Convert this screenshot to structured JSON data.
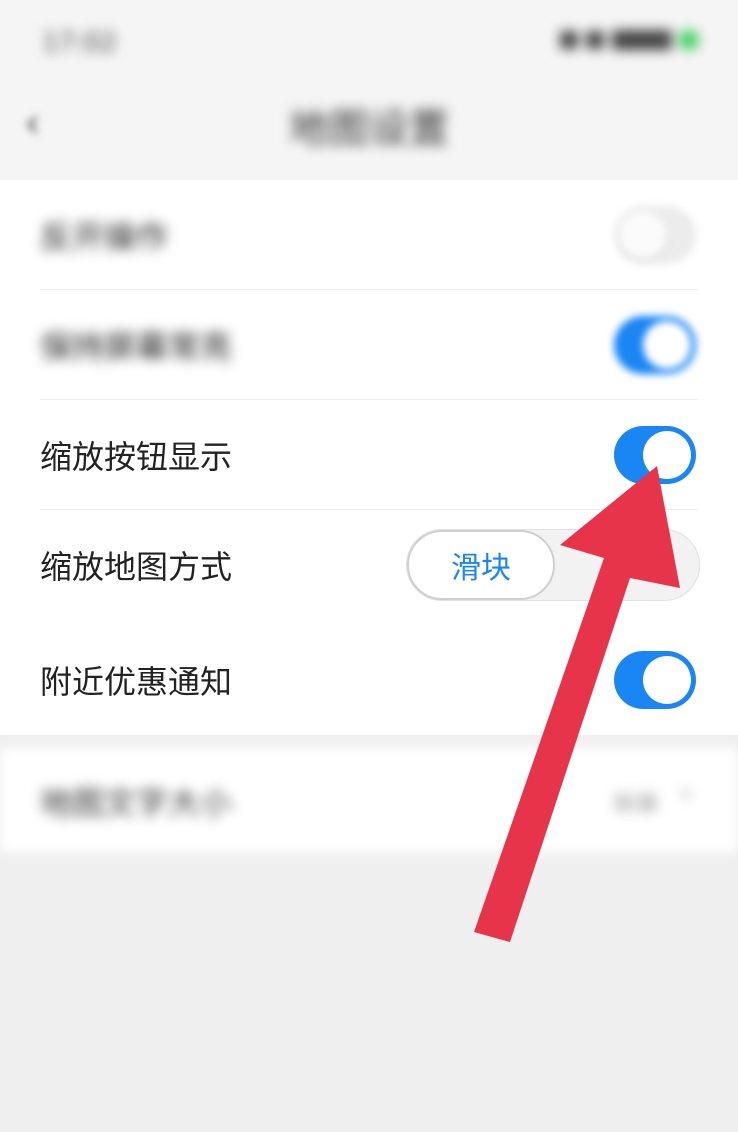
{
  "status_bar": {
    "time": "17:02"
  },
  "nav": {
    "title": "地图设置"
  },
  "settings": [
    {
      "label": "反开操作",
      "toggle_on": false
    },
    {
      "label": "保持屏幕常亮",
      "toggle_on": true
    },
    {
      "label": "缩放按钮显示",
      "toggle_on": true
    },
    {
      "label": "缩放地图方式",
      "segment_selected": "滑块"
    },
    {
      "label": "附近优惠通知",
      "toggle_on": true
    }
  ],
  "map_text_size": {
    "label": "地图文字大小",
    "value": "标准"
  },
  "colors": {
    "accent": "#1a86f3",
    "arrow": "#e8344a",
    "background": "#efefef"
  },
  "icons": {
    "back": "back-chevron-icon",
    "chevron": "chevron-right-icon",
    "annotation": "red-arrow-annotation"
  }
}
